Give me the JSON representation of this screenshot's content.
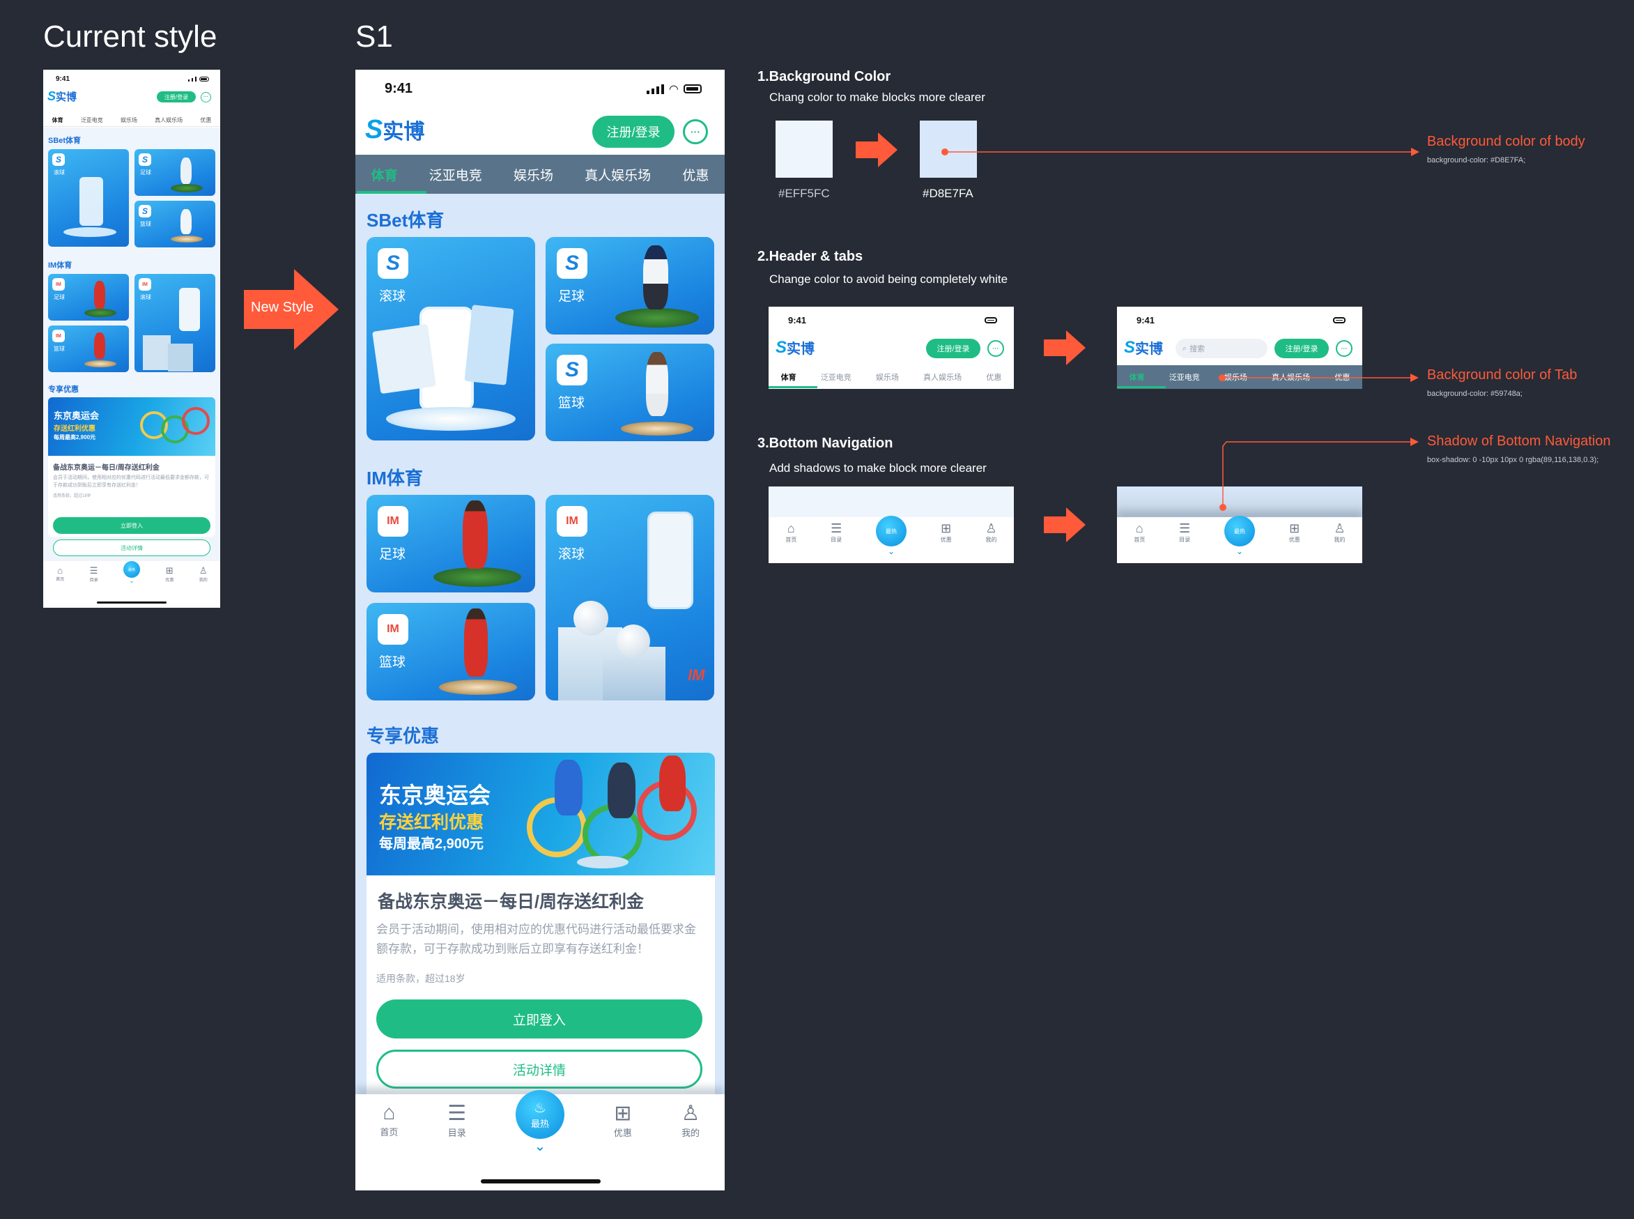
{
  "titles": {
    "current": "Current style",
    "s1": "S1"
  },
  "new_style_label": "New Style",
  "status": {
    "time": "9:41"
  },
  "app": {
    "logo_text": "实博",
    "register_label": "注册/登录",
    "tabs": [
      "体育",
      "泛亚电竞",
      "娱乐场",
      "真人娱乐场",
      "优惠"
    ],
    "sections": {
      "sbet": "SBet体育",
      "im": "IM体育",
      "promo": "专享优惠"
    },
    "cards": {
      "rollball": "滚球",
      "football": "足球",
      "basketball": "篮球"
    },
    "promo": {
      "banner_line1": "东京奥运会",
      "banner_line2": "存送红利优惠",
      "banner_line3": "每周最高2,900元",
      "title": "备战东京奥运－每日/周存送红利金",
      "desc": "会员于活动期间，使用相对应的优惠代码进行活动最低要求金额存款，可于存款成功到账后立即享有存送红利金！",
      "terms": "适用条款，超过18岁",
      "login_button": "立即登入",
      "details_button": "活动详情"
    },
    "bottom_nav": [
      "首页",
      "目录",
      "最热",
      "优惠",
      "我的"
    ],
    "search_placeholder": "搜索"
  },
  "annotations": {
    "bg": {
      "heading": "1.Background Color",
      "sub": "Chang color to make blocks more clearer",
      "old_hex": "#EFF5FC",
      "new_hex": "#D8E7FA",
      "callout": "Background color of body",
      "callout_code": "background-color: #D8E7FA;"
    },
    "header": {
      "heading": "2.Header & tabs",
      "sub": "Change color to avoid being completely white",
      "callout": "Background color of Tab",
      "callout_code": "background-color: #59748a;"
    },
    "nav": {
      "heading": "3.Bottom Navigation",
      "sub": "Add shadows to make block more clearer",
      "callout": "Shadow of Bottom Navigation",
      "callout_code": "box-shadow: 0 -10px 10px 0 rgba(89,116,138,0.3);"
    }
  },
  "colors": {
    "canvas": "#262b35",
    "accent_red": "#ff5a3a",
    "green": "#1fbd85",
    "body_old": "#EFF5FC",
    "body_new": "#D8E7FA",
    "tab_new": "#59748a"
  }
}
